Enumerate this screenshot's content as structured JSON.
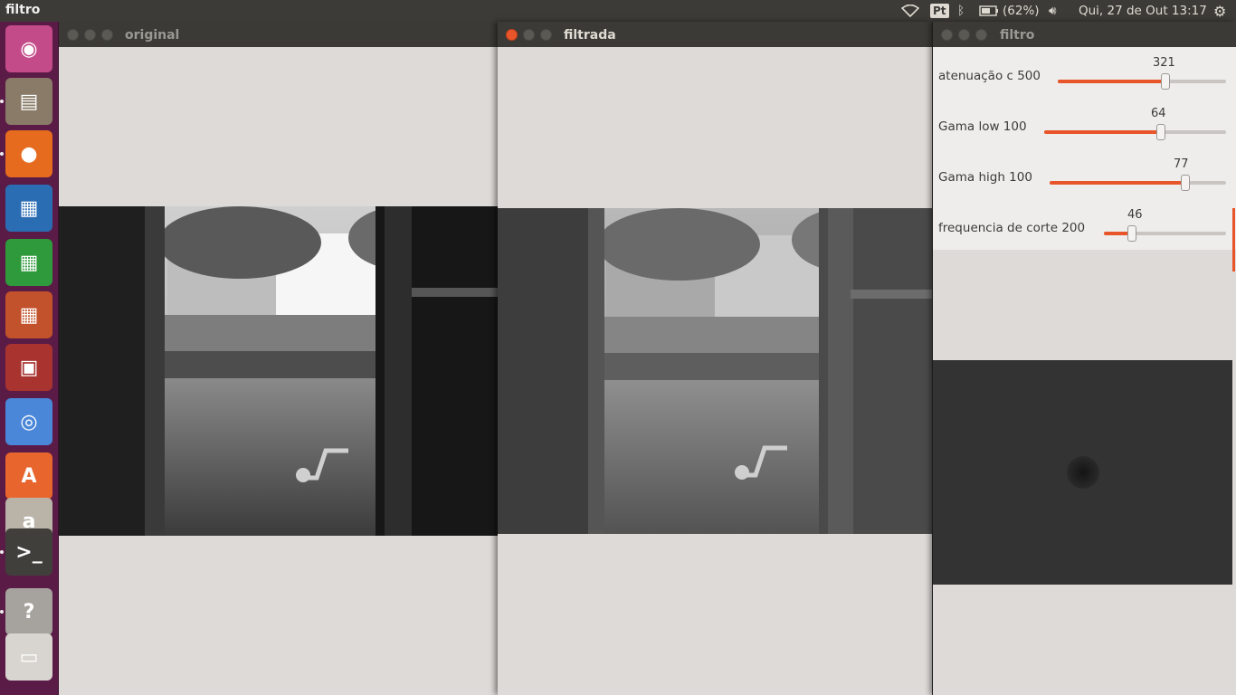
{
  "top_panel": {
    "app_title": "filtro",
    "keyboard_layout": "Pt",
    "battery": "(62%)",
    "datetime": "Qui, 27 de Out 13:17"
  },
  "launcher": {
    "items": [
      {
        "name": "ubuntu-dash-icon",
        "glyph": "◉",
        "color": "#c44b8a"
      },
      {
        "name": "files-icon",
        "glyph": "▤",
        "color": "#8a7b68"
      },
      {
        "name": "firefox-icon",
        "glyph": "●",
        "color": "#e66b1f"
      },
      {
        "name": "writer-icon",
        "glyph": "▦",
        "color": "#2b6db3"
      },
      {
        "name": "calc-icon",
        "glyph": "▦",
        "color": "#2e9a3c"
      },
      {
        "name": "impress-icon",
        "glyph": "▦",
        "color": "#c2522b"
      },
      {
        "name": "software-icon",
        "glyph": "▣",
        "color": "#a8332f"
      },
      {
        "name": "chrome-icon",
        "glyph": "◎",
        "color": "#4a87d8"
      },
      {
        "name": "app-store-icon",
        "glyph": "A",
        "color": "#e8662d"
      },
      {
        "name": "amazon-icon",
        "glyph": "a",
        "color": "#b9b3a8"
      },
      {
        "name": "terminal-icon",
        "glyph": ">_",
        "color": "#403f3b"
      },
      {
        "name": "help-icon",
        "glyph": "?",
        "color": "#a6a39e"
      },
      {
        "name": "workspaces-icon",
        "glyph": "▭",
        "color": "#d8d5d0"
      }
    ]
  },
  "windows": {
    "original": {
      "title": "original"
    },
    "filtrada": {
      "title": "filtrada"
    },
    "filtro": {
      "title": "filtro",
      "sliders": [
        {
          "label": "atenuação c 500",
          "value": "321",
          "fraction": 0.642
        },
        {
          "label": "Gama low 100",
          "value": "64",
          "fraction": 0.64
        },
        {
          "label": "Gama high 100",
          "value": "77",
          "fraction": 0.77
        },
        {
          "label": "frequencia de corte 200",
          "value": "46",
          "fraction": 0.23
        }
      ]
    }
  },
  "colors": {
    "accent": "#e9552a",
    "launcher": "#5a1b47",
    "panel": "#3c3b37"
  }
}
